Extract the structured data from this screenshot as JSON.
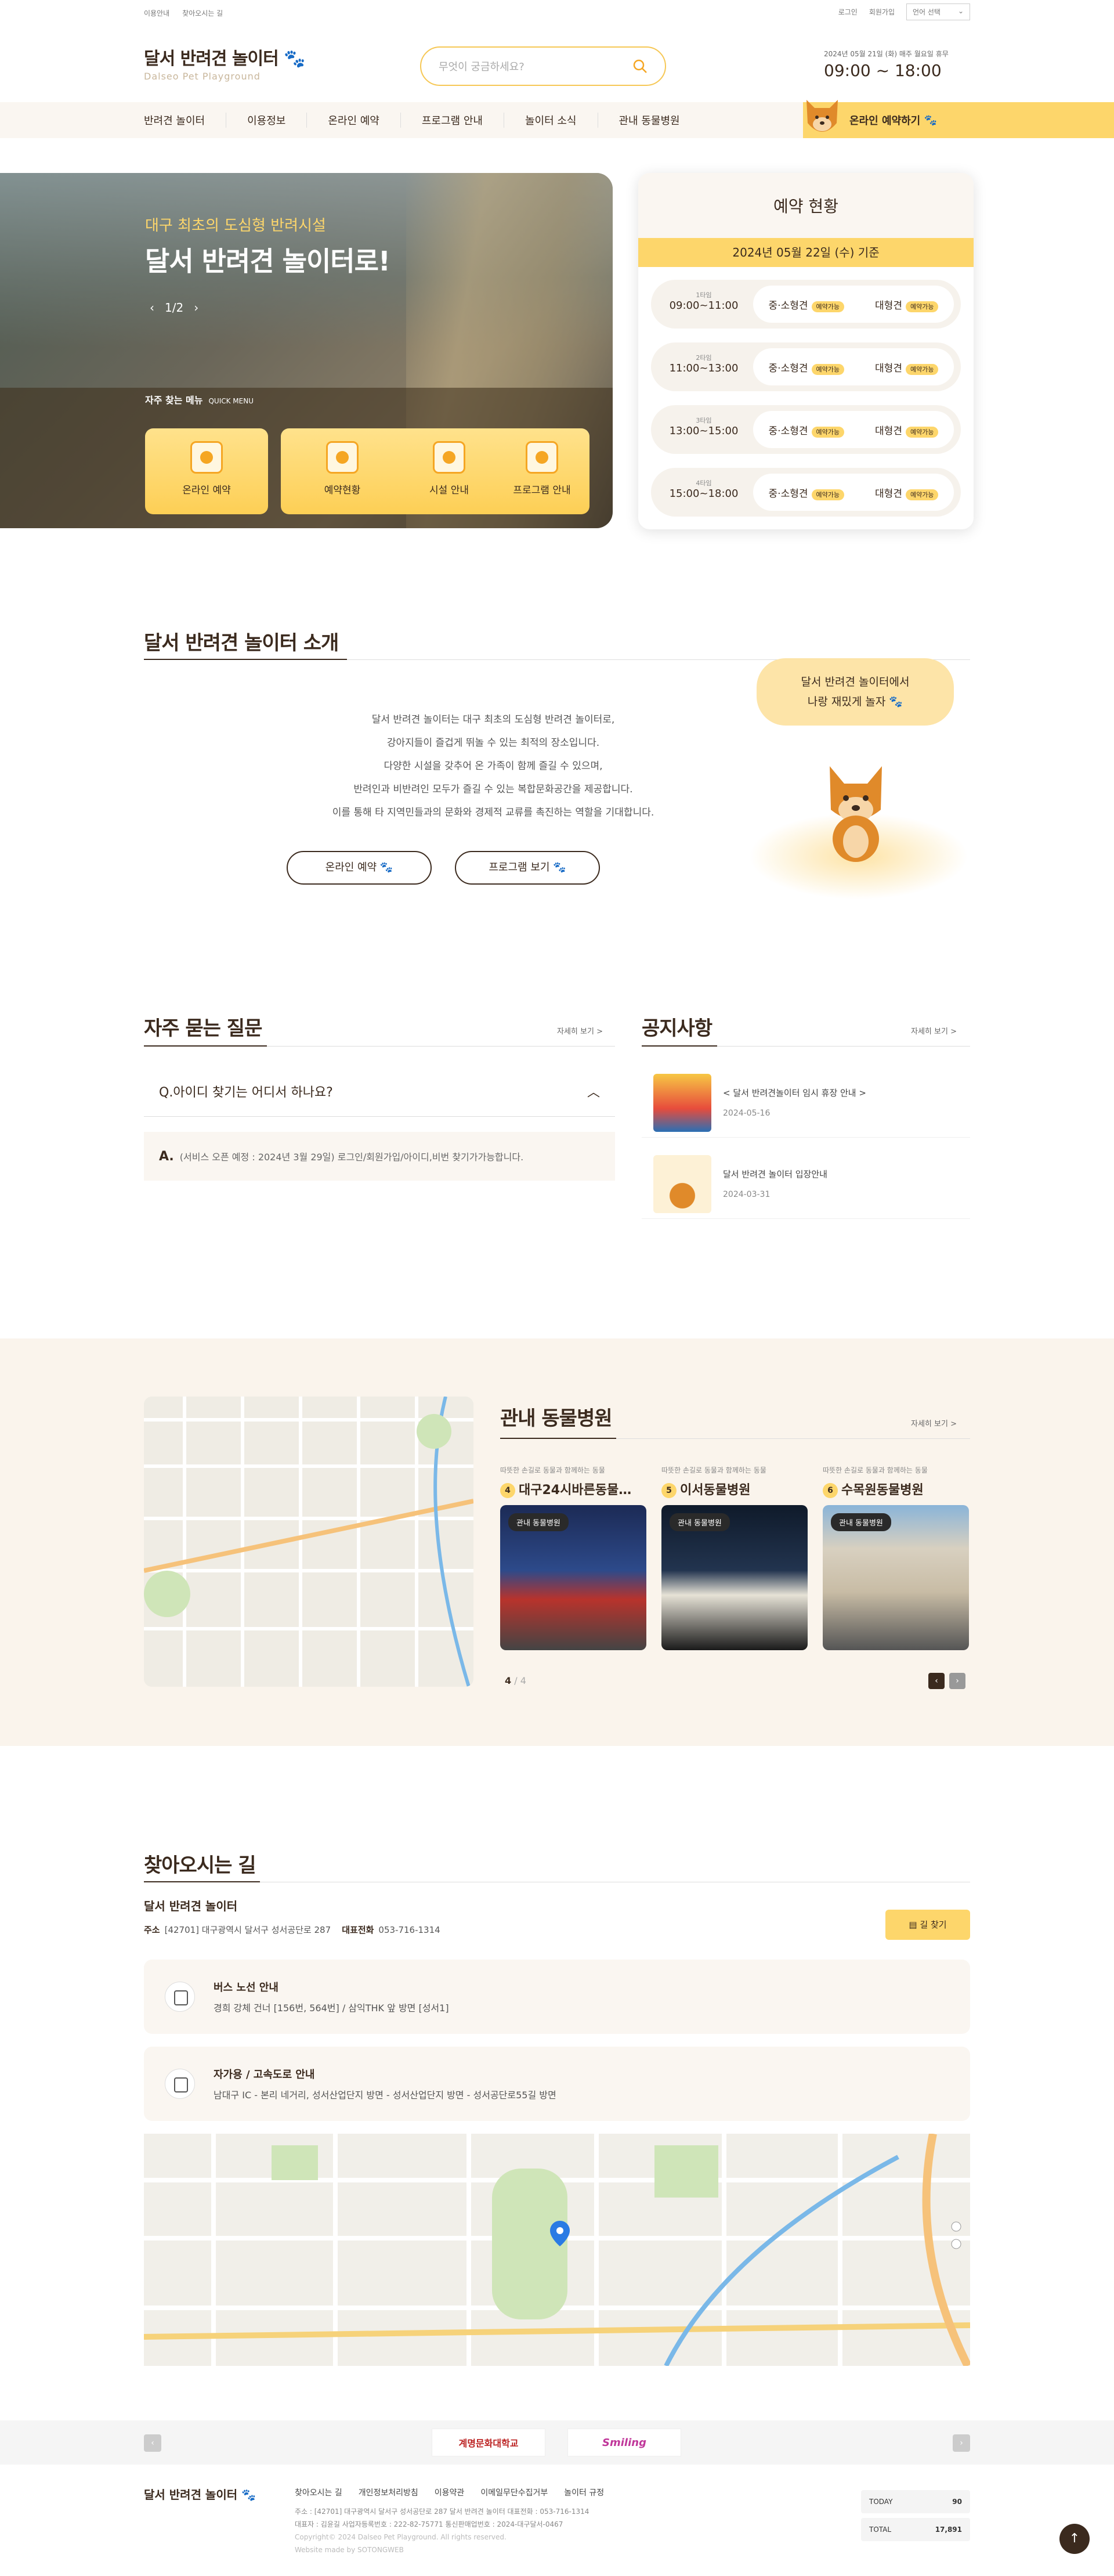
{
  "topbar": {
    "links_left": [
      "이용안내",
      "찾아오시는 길"
    ],
    "login": "로그인",
    "join": "회원가입",
    "lang": "언어 선택"
  },
  "logo": {
    "title": "달서 반려견 놀이터",
    "subtitle": "Dalseo Pet Playground"
  },
  "search": {
    "placeholder": "무엇이 궁금하세요?"
  },
  "hours": {
    "date": "2024년 05월 21일 (화)   매주 월요일 휴무",
    "time": "09:00 ~ 18:00"
  },
  "nav": {
    "items": [
      "반려견 놀이터",
      "이용정보",
      "온라인 예약",
      "프로그램 안내",
      "놀이터 소식",
      "관내 동물병원"
    ],
    "reserve": "온라인 예약하기"
  },
  "hero": {
    "subtitle": "대구 최초의 도심형 반려시설",
    "title": "달서 반려견 놀이터로!",
    "pager": "1/2",
    "quick_title": "자주 찾는 메뉴",
    "quick_sub": "QUICK MENU",
    "quick": [
      "온라인 예약",
      "예약현황",
      "시설 안내",
      "프로그램 안내"
    ]
  },
  "reservation": {
    "title": "예약 현황",
    "date": "2024년 05월 22일 (수) 기준",
    "slots": [
      {
        "part": "1타임",
        "time": "09:00~11:00",
        "small": "중·소형견",
        "small_tag": "예약가능",
        "large": "대형견",
        "large_tag": "예약가능"
      },
      {
        "part": "2타임",
        "time": "11:00~13:00",
        "small": "중·소형견",
        "small_tag": "예약가능",
        "large": "대형견",
        "large_tag": "예약가능"
      },
      {
        "part": "3타임",
        "time": "13:00~15:00",
        "small": "중·소형견",
        "small_tag": "예약가능",
        "large": "대형견",
        "large_tag": "예약가능"
      },
      {
        "part": "4타임",
        "time": "15:00~18:00",
        "small": "중·소형견",
        "small_tag": "예약가능",
        "large": "대형견",
        "large_tag": "예약가능"
      }
    ]
  },
  "intro": {
    "title": "달서 반려견 놀이터 소개",
    "lines": [
      "달서 반려견 놀이터는 대구 최초의 도심형 반려견 놀이터로,",
      "강아지들이 즐겁게 뛰놀 수 있는 최적의 장소입니다.",
      "다양한 시설을 갖추어 온 가족이 함께 즐길 수 있으며,",
      "반려인과 비반려인 모두가 즐길 수 있는 복합문화공간을 제공합니다.",
      "이를 통해 타 지역민들과의 문화와 경제적 교류를 촉진하는 역할을 기대합니다."
    ],
    "btn_reserve": "온라인 예약",
    "btn_program": "프로그램 보기",
    "bubble1": "달서 반려견 놀이터에서",
    "bubble2": "나랑 재밌게 놀자"
  },
  "faq": {
    "title": "자주 묻는 질문",
    "more": "자세히 보기 >",
    "question": "Q.아이디 찾기는 어디서 하나요?",
    "answer_mark": "A.",
    "answer": "(서비스 오픈 예정 : 2024년 3월 29일) 로그인/회원가입/아이디,비번 찾기가가능합니다."
  },
  "notice": {
    "title": "공지사항",
    "more": "자세히 보기 >",
    "items": [
      {
        "title": "< 달서 반려견놀이터 임시 휴장 안내 >",
        "date": "2024-05-16"
      },
      {
        "title": "달서 반려견 놀이터 입장안내",
        "date": "2024-03-31"
      }
    ]
  },
  "hospital": {
    "title": "관내 동물병원",
    "more": "자세히 보기 >",
    "page": "4",
    "total": "/ 4",
    "cards": [
      {
        "sub": "따뜻한 손길로 동물과 함께하는 동물",
        "num": "4",
        "name": "대구24시바른동물…",
        "label": "관내 동물병원"
      },
      {
        "sub": "따뜻한 손길로 동물과 함께하는 동물",
        "num": "5",
        "name": "이서동물병원",
        "label": "관내 동물병원"
      },
      {
        "sub": "따뜻한 손길로 동물과 함께하는 동물",
        "num": "6",
        "name": "수목원동물병원",
        "label": "관내 동물병원"
      }
    ]
  },
  "location": {
    "title": "찾아오시는 길",
    "name": "달서 반려견 놀이터",
    "addr_label": "주소",
    "addr": "[42701] 대구광역시 달서구 성서공단로 287",
    "tel_label": "대표전화",
    "tel": "053-716-1314",
    "btn": "길 찾기",
    "bus_title": "버스 노선 안내",
    "bus": "경희 강체 건너 [156번, 564번] / 삼익THK 앞 방면 [성서1]",
    "car_title": "자가용 / 고속도로 안내",
    "car": "남대구 IC - 본리 네거리, 성서산업단지 방면 - 성서산업단지 방면 - 성서공단로55길 방면"
  },
  "partners": [
    "계명문화대학교",
    "Smiling"
  ],
  "footer": {
    "logo": "달서 반려견 놀이터",
    "links": [
      "찾아오시는 길",
      "개인정보처리방침",
      "이용약관",
      "이메일무단수집거부",
      "놀이터 규정"
    ],
    "info1": "주소 : [42701] 대구광역시 달서구 성서공단로 287 달서 반려견 놀이터   대표전화 : 053-716-1314",
    "info2": "대표자 : 김윤길   사업자등록번호 : 222-82-75771   통신판매업번호 : 2024-대구달서-0467",
    "copy": "Copyright© 2024 Dalseo Pet Playground. All rights reserved.",
    "made": "Website made by SOTONGWEB",
    "today_label": "TODAY",
    "today": "90",
    "total_label": "TOTAL",
    "total": "17,891"
  }
}
